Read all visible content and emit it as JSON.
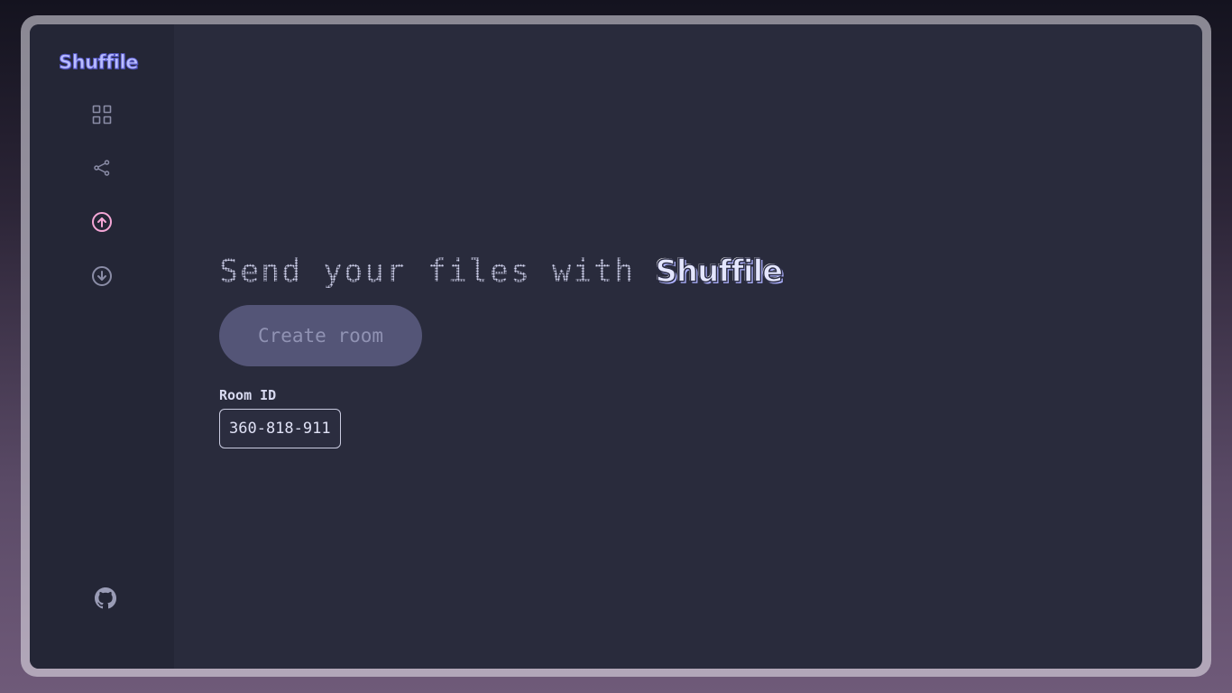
{
  "app": {
    "logo_text": "Shuffile"
  },
  "sidebar": {
    "items": [
      {
        "icon": "grid-icon",
        "active": false
      },
      {
        "icon": "share-icon",
        "active": false
      },
      {
        "icon": "upload-circle-icon",
        "active": true
      },
      {
        "icon": "download-circle-icon",
        "active": false
      }
    ],
    "footer_icon": "github-icon"
  },
  "main": {
    "headline": "Send your files with",
    "headline_brand": "Shuffile",
    "create_room_label": "Create room",
    "room_id_label": "Room ID",
    "room_id_value": "360-818-911"
  },
  "colors": {
    "accent": "#f4a6d6",
    "icon_inactive": "#8a8ca6",
    "button_bg": "#545577",
    "window_bg": "#292b3c",
    "sidebar_bg": "#242636"
  }
}
